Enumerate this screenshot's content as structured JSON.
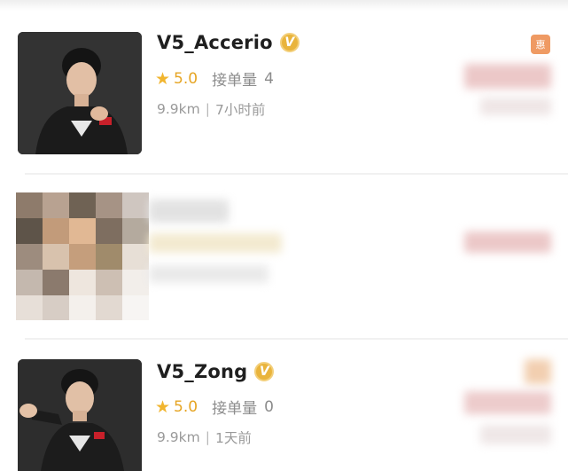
{
  "players": [
    {
      "name": "V5_Accerio",
      "verified_mark": "V",
      "rating": "5.0",
      "orders_label": "接单量",
      "orders_count": "4",
      "distance": "9.9km",
      "last_active": "7小时前",
      "promo_label": "惠"
    },
    {
      "name": "V5_Zong",
      "verified_mark": "V",
      "rating": "5.0",
      "orders_label": "接单量",
      "orders_count": "0",
      "distance": "9.9km",
      "last_active": "1天前"
    }
  ],
  "meta_separator": "|",
  "colors": {
    "rating": "#e6a524",
    "star": "#f1b52f",
    "verified_badge": "#e9b43c",
    "promo_badge": "#ef9a63",
    "name": "#1f1f1f",
    "secondary_text": "#8c8c8c"
  },
  "icons": {
    "star": "star-icon",
    "verified": "verified-v-icon",
    "promo": "promo-tag-icon"
  }
}
